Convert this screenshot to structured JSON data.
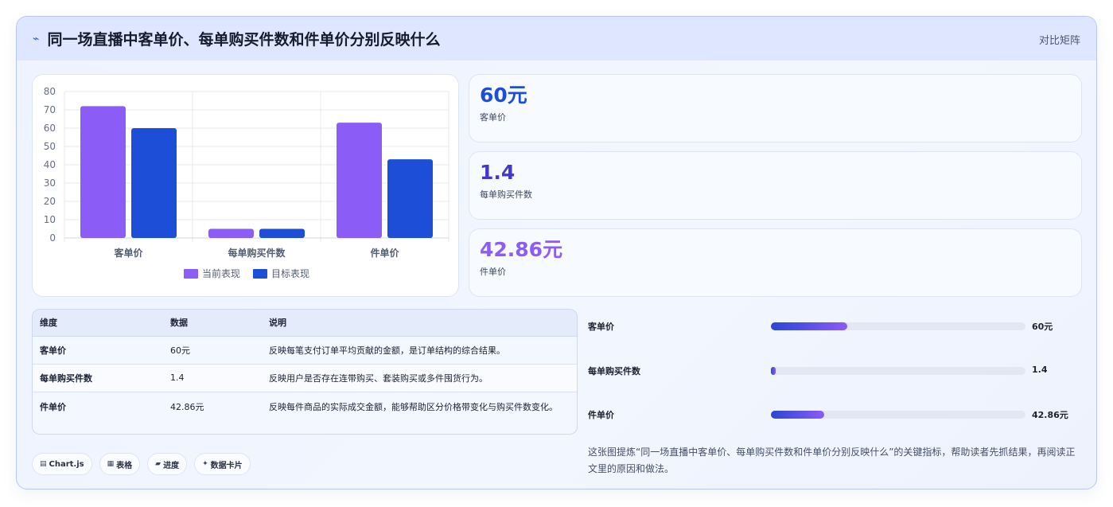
{
  "header": {
    "icon": "pulse-icon",
    "title": "同一场直播中客单价、每单购买件数和件单价分别反映什么",
    "tag": "对比矩阵"
  },
  "colors": {
    "current": "#8b5cf6",
    "target": "#1d4ed8",
    "value_blue": "#1d4ed8",
    "value_indigo": "#4338ca",
    "value_purple": "#8b5cf6"
  },
  "chart_data": {
    "type": "bar",
    "categories": [
      "客单价",
      "每单购买件数",
      "件单价"
    ],
    "series": [
      {
        "name": "当前表现",
        "values": [
          72,
          5,
          63
        ]
      },
      {
        "name": "目标表现",
        "values": [
          60,
          5,
          43
        ]
      }
    ],
    "ylim": [
      0,
      80
    ],
    "yticks": [
      0,
      10,
      20,
      30,
      40,
      50,
      60,
      70,
      80
    ],
    "grid": true,
    "legend": "bottom"
  },
  "stats": [
    {
      "value": "60元",
      "label": "客单价"
    },
    {
      "value": "1.4",
      "label": "每单购买件数"
    },
    {
      "value": "42.86元",
      "label": "件单价"
    }
  ],
  "table": {
    "headers": [
      "维度",
      "数据",
      "说明"
    ],
    "rows": [
      [
        "客单价",
        "60元",
        "反映每笔支付订单平均贡献的金额，是订单结构的综合结果。"
      ],
      [
        "每单购买件数",
        "1.4",
        "反映用户是否存在连带购买、套装购买或多件囤货行为。"
      ],
      [
        "件单价",
        "42.86元",
        "反映每件商品的实际成交金额，能够帮助区分价格带变化与购买件数变化。"
      ]
    ]
  },
  "progress": [
    {
      "label": "客单价",
      "value": "60元",
      "fraction": 0.3
    },
    {
      "label": "每单购买件数",
      "value": "1.4",
      "fraction": 0.02
    },
    {
      "label": "件单价",
      "value": "42.86元",
      "fraction": 0.21
    }
  ],
  "chips": [
    {
      "icon": "chart-icon",
      "glyph": "▤",
      "label": "Chart.js"
    },
    {
      "icon": "table-icon",
      "glyph": "▦",
      "label": "表格"
    },
    {
      "icon": "progress-icon",
      "glyph": "▰",
      "label": "进度"
    },
    {
      "icon": "sparkle-icon",
      "glyph": "✦",
      "label": "数据卡片"
    }
  ],
  "summary": "这张图提炼“同一场直播中客单价、每单购买件数和件单价分别反映什么”的关键指标，帮助读者先抓结果，再阅读正文里的原因和做法。"
}
